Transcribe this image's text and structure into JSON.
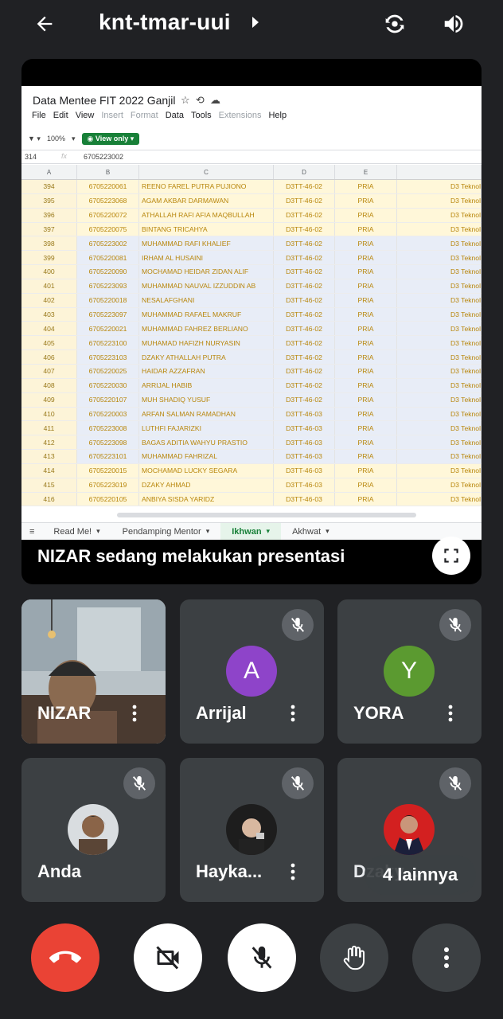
{
  "meeting": {
    "title": "knt-tmar-uui"
  },
  "icons": {
    "back": "back-arrow-icon",
    "switch_camera": "switch-camera-icon",
    "speaker": "speaker-icon"
  },
  "presentation": {
    "sheet_title": "Data Mentee FIT 2022 Ganjil",
    "menu": [
      "File",
      "Edit",
      "View",
      "Insert",
      "Format",
      "Data",
      "Tools",
      "Extensions",
      "Help"
    ],
    "menu_dim": [
      "Insert",
      "Format",
      "Extensions"
    ],
    "zoom": "100%",
    "view_only_label": "View only",
    "cell_ref": "314",
    "formula_value": "6705223002",
    "columns": [
      "A",
      "B",
      "C",
      "D",
      "E"
    ],
    "rows": [
      [
        "394",
        "6705220061",
        "REENO FAREL PUTRA PUJIONO",
        "D3TT-46-02",
        "PRIA",
        "D3 Teknol"
      ],
      [
        "395",
        "6705223068",
        "AGAM AKBAR DARMAWAN",
        "D3TT-46-02",
        "PRIA",
        "D3 Teknol"
      ],
      [
        "396",
        "6705220072",
        "ATHALLAH RAFI AFIA MAQBULLAH",
        "D3TT-46-02",
        "PRIA",
        "D3 Teknol"
      ],
      [
        "397",
        "6705220075",
        "BINTANG TRICAHYA",
        "D3TT-46-02",
        "PRIA",
        "D3 Teknol"
      ],
      [
        "398",
        "6705223002",
        "MUHAMMAD RAFI KHALIEF",
        "D3TT-46-02",
        "PRIA",
        "D3 Teknol"
      ],
      [
        "399",
        "6705220081",
        "IRHAM AL HUSAINI",
        "D3TT-46-02",
        "PRIA",
        "D3 Teknol"
      ],
      [
        "400",
        "6705220090",
        "MOCHAMAD HEIDAR ZIDAN ALIF",
        "D3TT-46-02",
        "PRIA",
        "D3 Teknol"
      ],
      [
        "401",
        "6705223093",
        "MUHAMMAD NAUVAL IZZUDDIN AB",
        "D3TT-46-02",
        "PRIA",
        "D3 Teknol"
      ],
      [
        "402",
        "6705220018",
        "NESALAFGHANI",
        "D3TT-46-02",
        "PRIA",
        "D3 Teknol"
      ],
      [
        "403",
        "6705223097",
        "MUHAMMAD RAFAEL MAKRUF",
        "D3TT-46-02",
        "PRIA",
        "D3 Teknol"
      ],
      [
        "404",
        "6705220021",
        "MUHAMMAD FAHREZ BERLIANO",
        "D3TT-46-02",
        "PRIA",
        "D3 Teknol"
      ],
      [
        "405",
        "6705223100",
        "MUHAMAD HAFIZH NURYASIN",
        "D3TT-46-02",
        "PRIA",
        "D3 Teknol"
      ],
      [
        "406",
        "6705223103",
        "DZAKY ATHALLAH PUTRA",
        "D3TT-46-02",
        "PRIA",
        "D3 Teknol"
      ],
      [
        "407",
        "6705220025",
        "HAIDAR AZZAFRAN",
        "D3TT-46-02",
        "PRIA",
        "D3 Teknol"
      ],
      [
        "408",
        "6705220030",
        "ARRIJAL HABIB",
        "D3TT-46-02",
        "PRIA",
        "D3 Teknol"
      ],
      [
        "409",
        "6705220107",
        "MUH SHADIQ YUSUF",
        "D3TT-46-02",
        "PRIA",
        "D3 Teknol"
      ],
      [
        "410",
        "6705220003",
        "ARFAN SALMAN RAMADHAN",
        "D3TT-46-03",
        "PRIA",
        "D3 Teknol"
      ],
      [
        "411",
        "6705223008",
        "LUTHFI FAJARIZKI",
        "D3TT-46-03",
        "PRIA",
        "D3 Teknol"
      ],
      [
        "412",
        "6705223098",
        "BAGAS ADITIA WAHYU PRASTIO",
        "D3TT-46-03",
        "PRIA",
        "D3 Teknol"
      ],
      [
        "413",
        "6705223101",
        "MUHAMMAD FAHRIZAL",
        "D3TT-46-03",
        "PRIA",
        "D3 Teknol"
      ],
      [
        "414",
        "6705220015",
        "MOCHAMAD LUCKY SEGARA",
        "D3TT-46-03",
        "PRIA",
        "D3 Teknol"
      ],
      [
        "415",
        "6705223019",
        "DZAKY AHMAD",
        "D3TT-46-03",
        "PRIA",
        "D3 Teknol"
      ],
      [
        "416",
        "6705220105",
        "ANBIYA SISDA YARIDZ",
        "D3TT-46-03",
        "PRIA",
        "D3 Teknol"
      ]
    ],
    "selected_row_range": [
      398,
      413
    ],
    "tabs": [
      {
        "label": "Read Me!",
        "active": false
      },
      {
        "label": "Pendamping Mentor",
        "active": false
      },
      {
        "label": "Ikhwan",
        "active": true
      },
      {
        "label": "Akhwat",
        "active": false
      }
    ],
    "caption": "NIZAR sedang melakukan presentasi"
  },
  "participants": [
    {
      "name": "NIZAR",
      "type": "video",
      "muted": false
    },
    {
      "name": "Arrijal",
      "type": "letter",
      "letter": "A",
      "color": "#8e44c9",
      "muted": true
    },
    {
      "name": "YORA",
      "type": "letter",
      "letter": "Y",
      "color": "#5b9a30",
      "muted": true
    },
    {
      "name": "Anda",
      "type": "photo",
      "muted": true
    },
    {
      "name": "Hayka...",
      "type": "photo",
      "muted": true
    },
    {
      "name": "Dzaky ...",
      "type": "photo",
      "muted": true
    }
  ],
  "overflow_label": "4 lainnya",
  "colors": {
    "end_call": "#ea4335",
    "tile_bg": "#3c4043",
    "page_bg": "#202124",
    "view_only_green": "#188038"
  }
}
